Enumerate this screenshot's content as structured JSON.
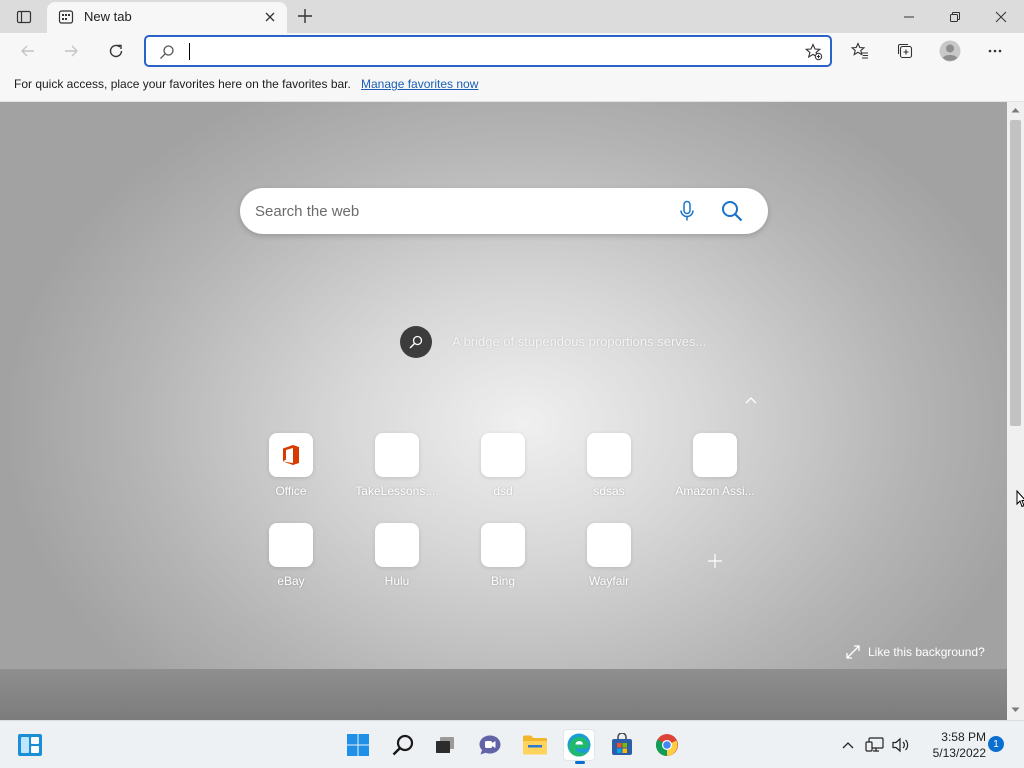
{
  "tab": {
    "title": "New tab"
  },
  "address": {
    "value": "",
    "placeholder": ""
  },
  "favorites_bar": {
    "message": "For quick access, place your favorites here on the favorites bar.",
    "link": "Manage favorites now"
  },
  "ntp": {
    "search_placeholder": "Search the web",
    "background_info": "A bridge of stupendous proportions serves...",
    "quick_links": [
      {
        "label": "Office"
      },
      {
        "label": "TakeLessons...."
      },
      {
        "label": "dsd"
      },
      {
        "label": "sdsas"
      },
      {
        "label": "Amazon Assi..."
      },
      {
        "label": "eBay"
      },
      {
        "label": "Hulu"
      },
      {
        "label": "Bing"
      },
      {
        "label": "Wayfair"
      }
    ],
    "like_background": "Like this background?"
  },
  "taskbar": {
    "time": "3:58 PM",
    "date": "5/13/2022",
    "notification_count": "1"
  },
  "colors": {
    "accent": "#2a62c9",
    "link": "#1a5fb4",
    "office_red": "#d83b01",
    "taskbar_accent": "#0b6fd1"
  }
}
